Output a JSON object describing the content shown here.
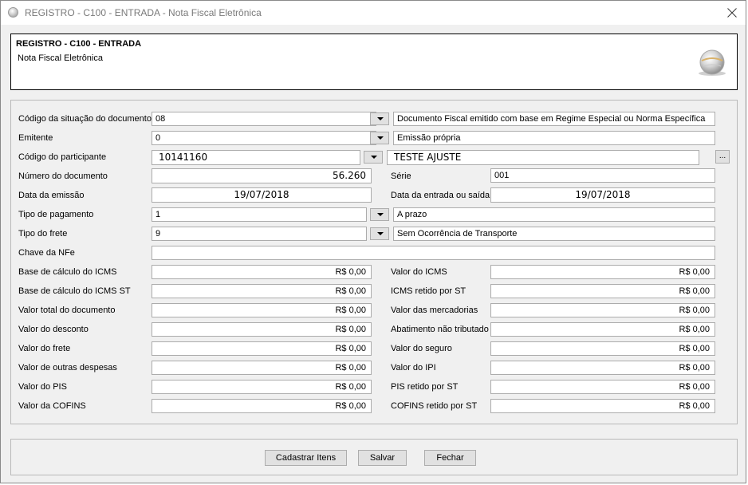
{
  "window": {
    "title": "REGISTRO - C100 - ENTRADA - Nota Fiscal Eletrônica",
    "close_icon": "close-icon",
    "app_icon": "app-globe-icon"
  },
  "header": {
    "title": "REGISTRO - C100 - ENTRADA",
    "subtitle": "Nota Fiscal Eletrônica",
    "logo_icon": "globe-logo-icon"
  },
  "form": {
    "situacao": {
      "label": "Código da situação do documento",
      "code": "08",
      "description": "Documento Fiscal emitido com base em Regime Especial ou Norma Específica"
    },
    "emitente": {
      "label": "Emitente",
      "code": "0",
      "description": "Emissão própria"
    },
    "participante": {
      "label": "Código do participante",
      "code": "10141160",
      "description": "TESTE AJUSTE",
      "lookup_label": "..."
    },
    "numero": {
      "label": "Número do documento",
      "value": "56.260"
    },
    "serie": {
      "label": "Série",
      "value": "001"
    },
    "data_emissao": {
      "label": "Data da emissão",
      "value": "19/07/2018"
    },
    "data_entrada": {
      "label": "Data da entrada ou saída",
      "value": "19/07/2018"
    },
    "pagamento": {
      "label": "Tipo de pagamento",
      "code": "1",
      "description": "A prazo"
    },
    "frete": {
      "label": "Tipo do frete",
      "code": "9",
      "description": "Sem Ocorrência de Transporte"
    },
    "chave": {
      "label": "Chave da NFe",
      "value": ""
    },
    "values_left": [
      {
        "label": "Base de cálculo do ICMS",
        "value": "R$ 0,00"
      },
      {
        "label": "Base de cálculo do ICMS ST",
        "value": "R$ 0,00"
      },
      {
        "label": "Valor total do documento",
        "value": "R$ 0,00"
      },
      {
        "label": "Valor do desconto",
        "value": "R$ 0,00"
      },
      {
        "label": "Valor do frete",
        "value": "R$ 0,00"
      },
      {
        "label": "Valor de outras despesas",
        "value": "R$ 0,00"
      },
      {
        "label": "Valor do PIS",
        "value": "R$ 0,00"
      },
      {
        "label": "Valor da COFINS",
        "value": "R$ 0,00"
      }
    ],
    "values_right": [
      {
        "label": "Valor do ICMS",
        "value": "R$ 0,00"
      },
      {
        "label": "ICMS retido por ST",
        "value": "R$ 0,00"
      },
      {
        "label": "Valor das mercadorias",
        "value": "R$ 0,00"
      },
      {
        "label": "Abatimento não tributado",
        "value": "R$ 0,00"
      },
      {
        "label": "Valor do seguro",
        "value": "R$ 0,00"
      },
      {
        "label": "Valor do IPI",
        "value": "R$ 0,00"
      },
      {
        "label": "PIS retido por ST",
        "value": "R$ 0,00"
      },
      {
        "label": "COFINS retido por ST",
        "value": "R$ 0,00"
      }
    ]
  },
  "buttons": {
    "cadastrar": "Cadastrar Itens",
    "salvar": "Salvar",
    "fechar": "Fechar"
  }
}
